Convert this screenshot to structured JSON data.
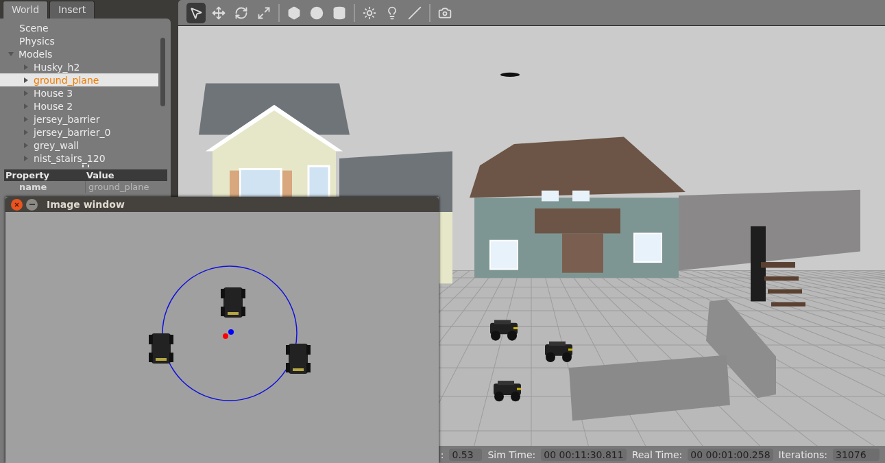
{
  "panel": {
    "tabs": [
      {
        "label": "World",
        "selected": true
      },
      {
        "label": "Insert",
        "selected": false
      }
    ],
    "tree": [
      {
        "label": "Scene",
        "selected": false
      },
      {
        "label": "Physics",
        "selected": false
      },
      {
        "label": "Models",
        "selected": false,
        "expanded": true,
        "children": [
          {
            "label": "Husky_h2",
            "selected": false,
            "expanded": false
          },
          {
            "label": "ground_plane",
            "selected": true,
            "expanded": false
          },
          {
            "label": "House 3",
            "selected": false,
            "expanded": false
          },
          {
            "label": "House 2",
            "selected": false,
            "expanded": false
          },
          {
            "label": "jersey_barrier",
            "selected": false,
            "expanded": false
          },
          {
            "label": "jersey_barrier_0",
            "selected": false,
            "expanded": false
          },
          {
            "label": "grey_wall",
            "selected": false,
            "expanded": false
          },
          {
            "label": "nist_stairs_120",
            "selected": false,
            "expanded": false
          }
        ]
      }
    ],
    "properties": {
      "columns": [
        "Property",
        "Value"
      ],
      "rows": [
        {
          "property": "name",
          "value": "ground_plane"
        }
      ]
    }
  },
  "toolbar": {
    "tools": [
      {
        "selected": true
      },
      {
        "selected": false
      },
      {
        "selected": false
      },
      {
        "selected": false
      },
      {
        "selected": false
      },
      {
        "selected": false
      },
      {
        "selected": false
      },
      {
        "selected": false
      },
      {
        "selected": false
      },
      {
        "selected": false
      },
      {
        "selected": false
      }
    ]
  },
  "status_bar": [
    {
      "label": ":",
      "value": "0.53"
    },
    {
      "label": "Sim Time:",
      "value": "00 00:11:30.811"
    },
    {
      "label": "Real Time:",
      "value": "00 00:01:00.258"
    },
    {
      "label": "Iterations:",
      "value": "31076"
    }
  ],
  "image_window": {
    "title": "Image window"
  }
}
